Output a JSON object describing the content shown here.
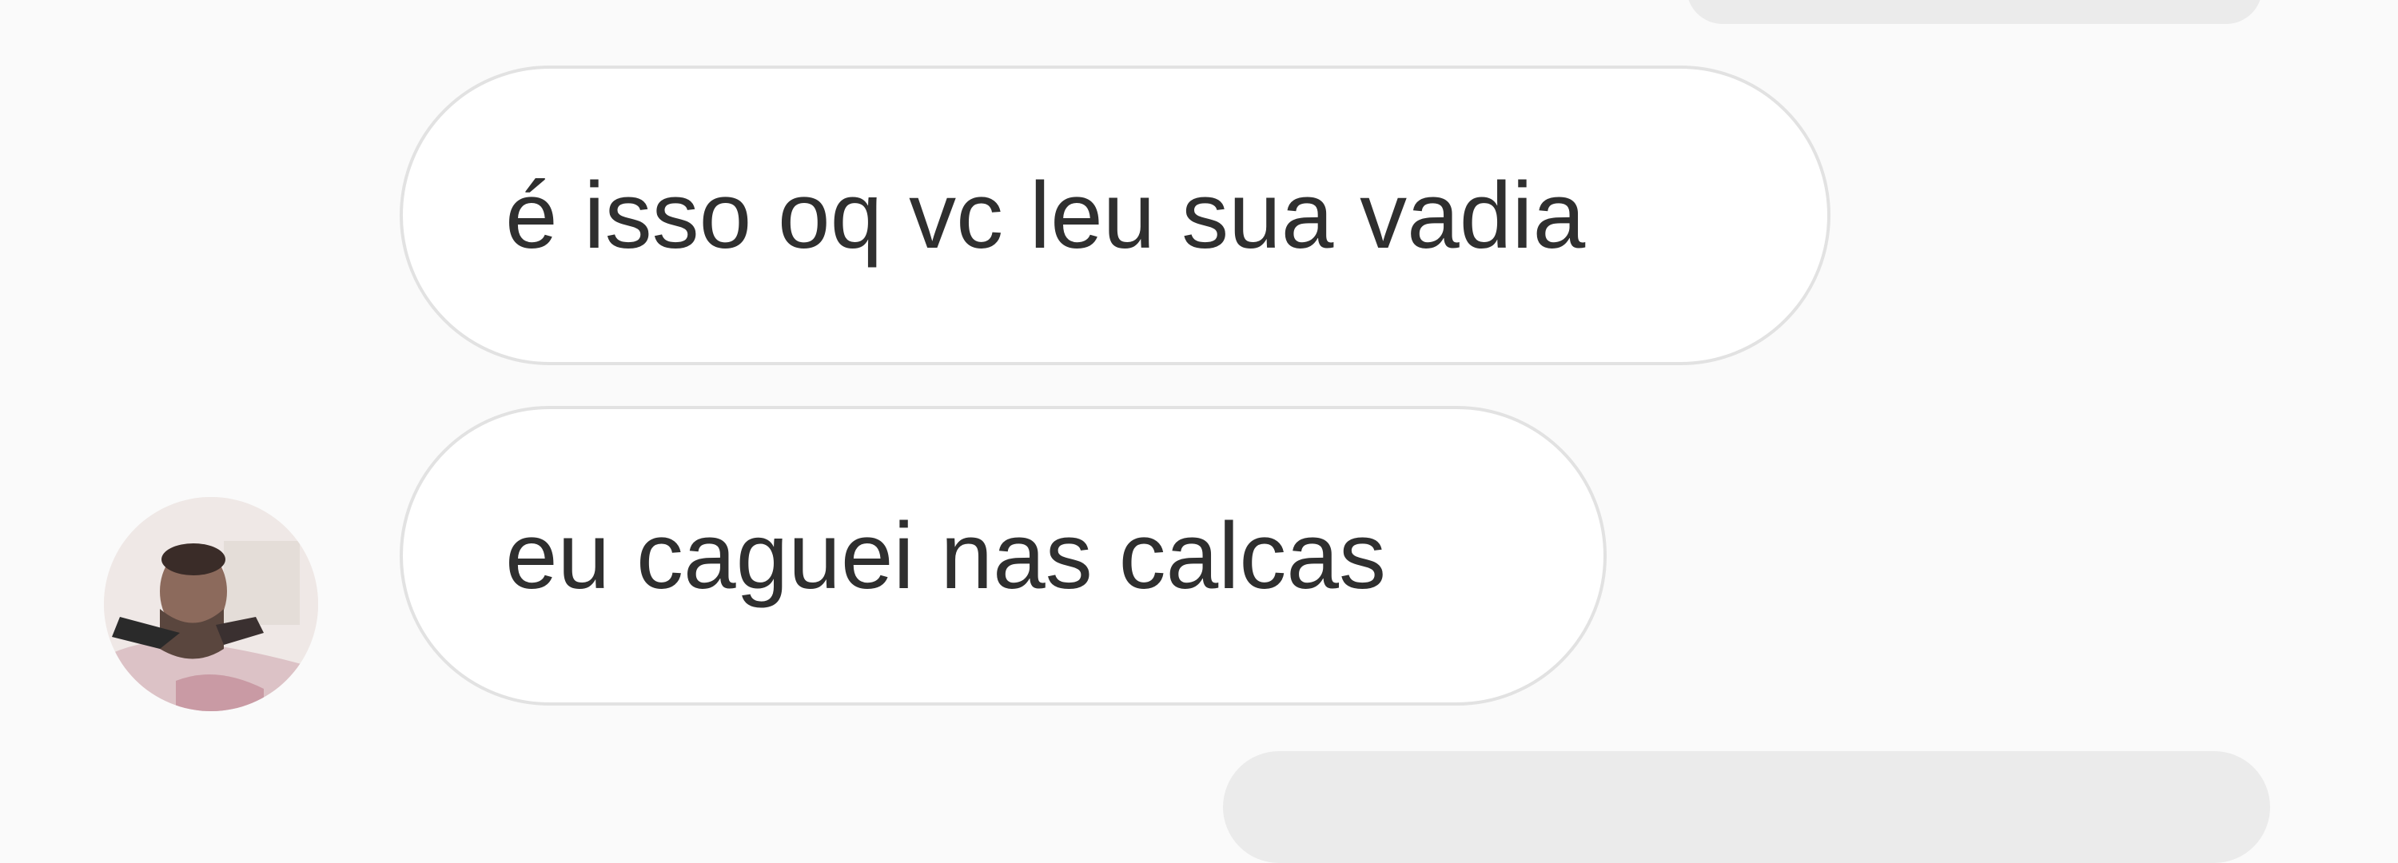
{
  "thread": {
    "messages": [
      {
        "sender": "contact",
        "text": "é isso oq vc leu sua vadia"
      },
      {
        "sender": "contact",
        "text": "eu caguei nas calcas"
      }
    ]
  },
  "colors": {
    "background": "#fafafa",
    "received_bubble": "#ffffff",
    "received_border": "#e2e2e2",
    "sent_bubble": "#ebebeb",
    "text": "#2f2f2f"
  },
  "icons": {
    "avatar": "contact-avatar-photo"
  }
}
